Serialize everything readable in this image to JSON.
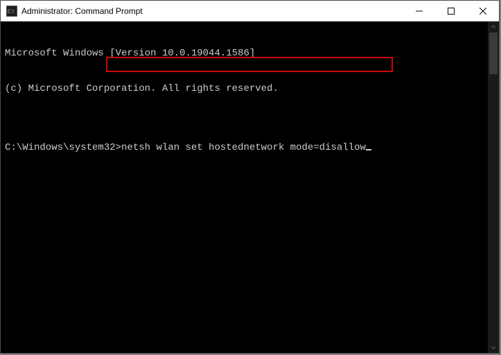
{
  "window": {
    "title": "Administrator: Command Prompt"
  },
  "terminal": {
    "line1": "Microsoft Windows [Version 10.0.19044.1586]",
    "line2": "(c) Microsoft Corporation. All rights reserved.",
    "blank": "",
    "prompt": "C:\\Windows\\system32>",
    "command": "netsh wlan set hostednetwork mode=disallow"
  },
  "icons": {
    "app": "cmd-icon",
    "minimize": "minimize-icon",
    "maximize": "maximize-icon",
    "close": "close-icon"
  }
}
